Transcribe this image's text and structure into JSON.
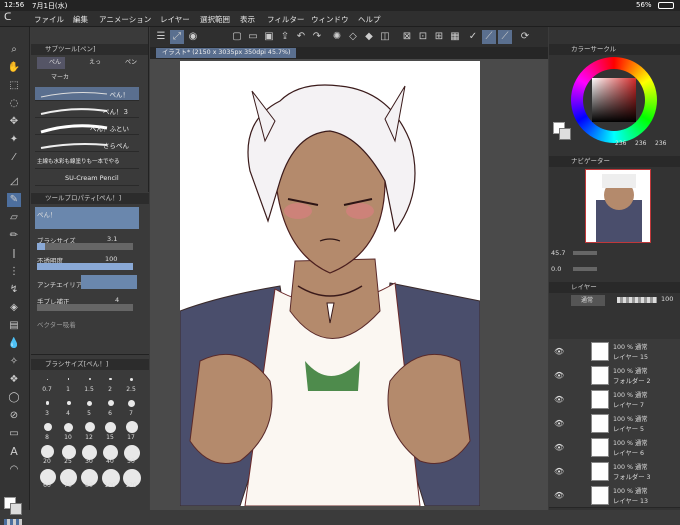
{
  "status": {
    "time": "12:56",
    "date": "7月1日(水)",
    "battery": "56%"
  },
  "menu": [
    "ファイル",
    "編集",
    "アニメーション",
    "レイヤー",
    "選択範囲",
    "表示",
    "フィルター",
    "ウィンドウ",
    "ヘルプ"
  ],
  "subtool": {
    "title": "サブツール[ペン]",
    "tabs": [
      "ぺん",
      "えっ",
      "ペン"
    ],
    "group": "マーカ",
    "brushes": [
      "ぺん！",
      "ぺん！３",
      "ぺん！ふとい",
      "さらぺん",
      "主線も水彩も線塗りも一本でやる",
      "SU-Cream Pencil"
    ]
  },
  "toolprop": {
    "title": "ツールプロパティ[ぺん！]",
    "name": "ぺん！",
    "size_label": "ブラシサイズ",
    "size_value": "3.1",
    "opacity_label": "不透明度",
    "opacity_value": "100",
    "aa_label": "アンチエイリア",
    "stab_label": "手ブレ補正",
    "stab_value": "4",
    "vector_label": "ベクター吸着"
  },
  "brushsize": {
    "title": "ブラシサイズ[ぺん！]",
    "labels": [
      "0.7",
      "1",
      "1.5",
      "2",
      "2.5",
      "3",
      "4",
      "5",
      "6",
      "7",
      "8",
      "10",
      "12",
      "15",
      "17",
      "20",
      "25",
      "30",
      "40",
      "50",
      "60",
      "70",
      "80",
      "100",
      "120"
    ]
  },
  "document": {
    "tab": "イラスト* (2150 x 3035px 350dpi 45.7%)"
  },
  "colorcircle": {
    "title": "カラーサークル",
    "r": "236",
    "g": "236",
    "b": "236",
    "accent": "#d42b2b"
  },
  "navigator": {
    "title": "ナビゲーター",
    "zoom": "45.7",
    "angle": "0.0"
  },
  "layers": {
    "title": "レイヤー",
    "blend": "通常",
    "opacity": "100",
    "items": [
      {
        "l1": "100 % 通常",
        "l2": "レイヤー 15"
      },
      {
        "l1": "100 % 通常",
        "l2": "フォルダー 2"
      },
      {
        "l1": "100 % 通常",
        "l2": "レイヤー 7"
      },
      {
        "l1": "100 % 通常",
        "l2": "レイヤー 5"
      },
      {
        "l1": "100 % 通常",
        "l2": "レイヤー 6"
      },
      {
        "l1": "100 % 通常",
        "l2": "フォルダー 3"
      },
      {
        "l1": "100 % 通常",
        "l2": "レイヤー 13"
      }
    ]
  }
}
